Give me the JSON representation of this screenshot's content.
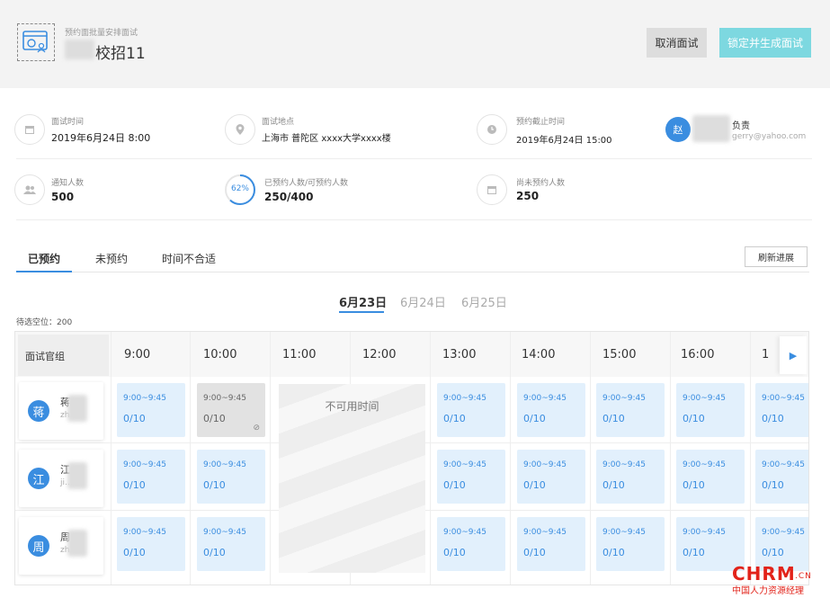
{
  "header": {
    "subtitle": "预约面批量安排面试",
    "title": "校招11",
    "cancel_label": "取消面试",
    "confirm_label": "锁定并生成面试"
  },
  "info": {
    "time_label": "面试时间",
    "time_value": "2019年6月24日 8:00",
    "location_label": "面试地点",
    "location_value": "上海市 普陀区 xxxx大学xxxx楼",
    "deadline_label": "预约截止时间",
    "deadline_value": "2019年6月24日 15:00",
    "owner_avatar": "赵",
    "owner_label": "负责",
    "owner_email": "gerry@yahoo.com",
    "notified_label": "通知人数",
    "notified_value": "500",
    "progress_percent": "62%",
    "progress_fraction": 0.62,
    "booked_label": "已预约人数/可预约人数",
    "booked_value": "250/400",
    "unbooked_label": "尚未预约人数",
    "unbooked_value": "250"
  },
  "tabs": [
    "已预约",
    "未预约",
    "时间不合适"
  ],
  "active_tab": 0,
  "refresh_label": "刷新进展",
  "dates": [
    "6月23日",
    "6月24日",
    "6月25日"
  ],
  "active_date": 0,
  "pending_slots": "待选空位：200",
  "grid": {
    "group_header": "面试官组",
    "hours": [
      "9:00",
      "10:00",
      "11:00",
      "12:00",
      "13:00",
      "14:00",
      "15:00",
      "16:00",
      "1"
    ],
    "unavailable_label": "不可用时间",
    "interviewers": [
      {
        "avatar": "蒋",
        "name": "蒋",
        "email": "zh..."
      },
      {
        "avatar": "江",
        "name": "江",
        "email": "ji..."
      },
      {
        "avatar": "周",
        "name": "周",
        "email": "zh..."
      }
    ],
    "slot_time": "9:00~9:45",
    "slot_count": "0/10"
  },
  "colors": {
    "accent": "#3a8de0",
    "confirm": "#7dd8e0",
    "slot": "#e2f0fc"
  },
  "watermark": {
    "main": "CHRM",
    "suffix": ".CN",
    "sub": "中国人力资源经理"
  }
}
